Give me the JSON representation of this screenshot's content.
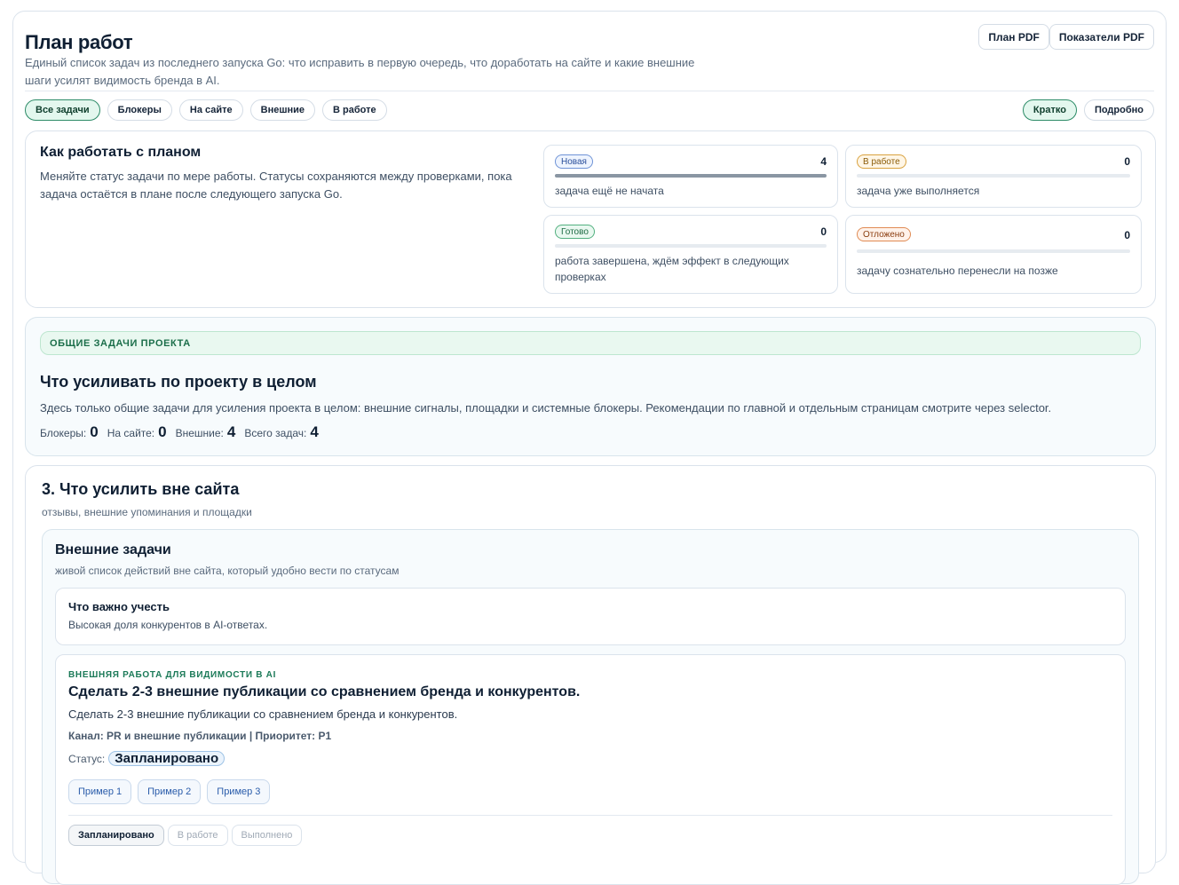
{
  "header": {
    "title": "План работ",
    "subtitle": "Единый список задач из последнего запуска Go: что исправить в первую очередь, что доработать на сайте и какие внешние шаги усилят видимость бренда в AI.",
    "pdf_plan": "План PDF",
    "pdf_metrics": "Показатели PDF"
  },
  "filters": [
    "Все задачи",
    "Блокеры",
    "На сайте",
    "Внешние",
    "В работе"
  ],
  "view_modes": [
    "Кратко",
    "Подробно"
  ],
  "how": {
    "title": "Как работать с планом",
    "text": "Меняйте статус задачи по мере работы. Статусы сохраняются между проверками, пока задача остаётся в плане после следующего запуска Go.",
    "stats": [
      {
        "label": "Новая",
        "count": "4",
        "desc": "задача ещё не начата",
        "fill": 1.0
      },
      {
        "label": "В работе",
        "count": "0",
        "desc": "задача уже выполняется",
        "fill": 0
      },
      {
        "label": "Готово",
        "count": "0",
        "desc": "работа завершена, ждём эффект в следующих проверках",
        "fill": 0
      },
      {
        "label": "Отложено",
        "count": "0",
        "desc": "задачу сознательно перенесли на позже",
        "fill": 0
      }
    ]
  },
  "project": {
    "banner": "ОБЩИЕ ЗАДАЧИ ПРОЕКТА",
    "title": "Что усиливать по проекту в целом",
    "text": "Здесь только общие задачи для усиления проекта в целом: внешние сигналы, площадки и системные блокеры. Рекомендации по главной и отдельным страницам смотрите через selector.",
    "metrics": {
      "blockers_label": "Блокеры:",
      "blockers": "0",
      "onsite_label": "На сайте:",
      "onsite": "0",
      "external_label": "Внешние:",
      "external": "4",
      "total_label": "Всего задач:",
      "total": "4"
    }
  },
  "external": {
    "title": "3. Что усилить вне сайта",
    "subtitle": "отзывы, внешние упоминания и площадки",
    "inner_title": "Внешние задачи",
    "inner_subtitle": "живой список действий вне сайта, который удобно вести по статусам",
    "note_title": "Что важно учесть",
    "note_text": "Высокая доля конкурентов в AI-ответах.",
    "task": {
      "kicker": "ВНЕШНЯЯ РАБОТА ДЛЯ ВИДИМОСТИ В AI",
      "title": "Сделать 2-3 внешние публикации со сравнением бренда и конкурентов.",
      "text": "Сделать 2-3 внешние публикации со сравнением бренда и конкурентов.",
      "meta": "Канал: PR и внешние публикации | Приоритет: P1",
      "status_label": "Статус:",
      "status_value": "Запланировано",
      "examples": [
        "Пример 1",
        "Пример 2",
        "Пример 3"
      ],
      "status_tabs": [
        "Запланировано",
        "В работе",
        "Выполнено"
      ]
    }
  }
}
